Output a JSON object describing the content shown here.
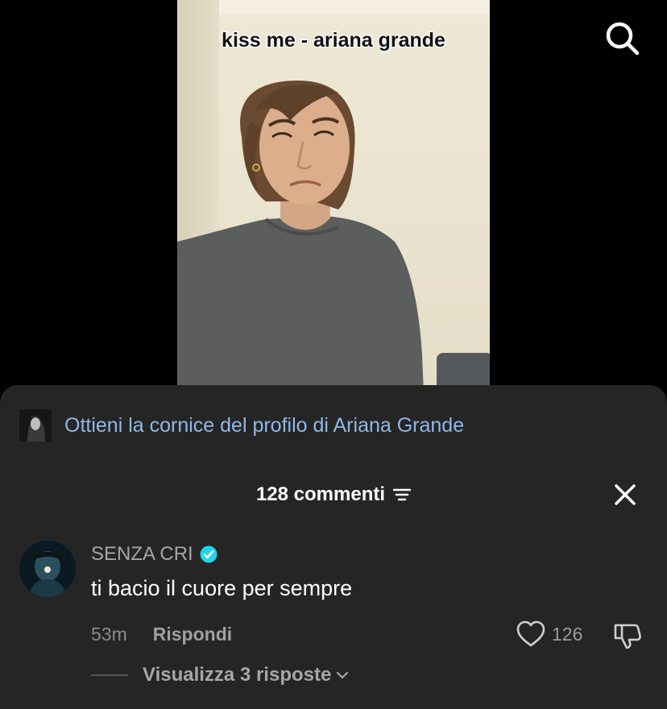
{
  "video": {
    "caption": "kiss me - ariana grande"
  },
  "icons": {
    "search": "search-icon",
    "sort": "sort-icon",
    "close": "close-icon",
    "verified": "verified-badge-icon",
    "like": "heart-icon",
    "dislike": "thumbs-down-icon",
    "expand": "chevron-down-icon"
  },
  "promo": {
    "text": "Ottieni la cornice del profilo di Ariana Grande"
  },
  "comments_panel": {
    "title": "128 commenti",
    "comment": {
      "username": "SENZA CRI",
      "text": "ti bacio il cuore per sempre",
      "time": "53m",
      "reply_label": "Rispondi",
      "likes": "126",
      "view_replies": "Visualizza 3 risposte"
    }
  },
  "colors": {
    "sheet_bg": "#252525",
    "promo_link": "#8fb8e6",
    "verified": "#20d5ec",
    "muted_text": "#a6a6a6"
  }
}
